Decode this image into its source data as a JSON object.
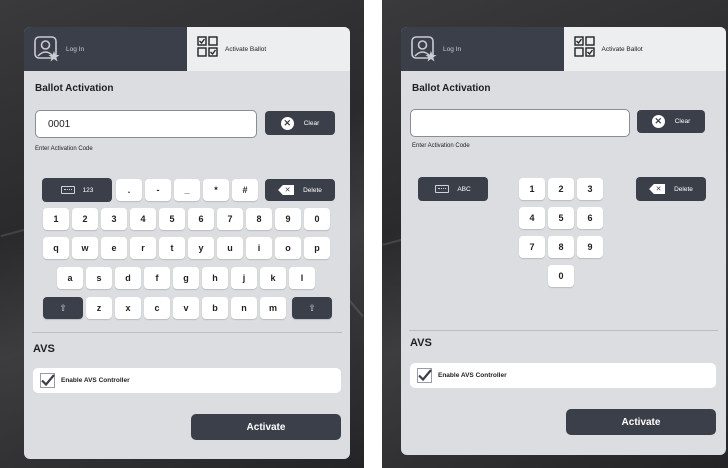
{
  "left": {
    "tabs": {
      "login": "Log In",
      "activate": "Activate Ballot"
    },
    "heading": "Ballot Activation",
    "code_value": "0001",
    "clear": "Clear",
    "hint": "Enter Activation Code",
    "mode_key": {
      "icon": "keyboard-icon",
      "label": "123"
    },
    "symbol_keys": [
      ".",
      "-",
      "_",
      "*",
      "#"
    ],
    "delete": "Delete",
    "row_numbers": [
      "1",
      "2",
      "3",
      "4",
      "5",
      "6",
      "7",
      "8",
      "9",
      "0"
    ],
    "row_q": [
      "q",
      "w",
      "e",
      "r",
      "t",
      "y",
      "u",
      "i",
      "o",
      "p"
    ],
    "row_a": [
      "a",
      "s",
      "d",
      "f",
      "g",
      "h",
      "j",
      "k",
      "l"
    ],
    "row_z": [
      "z",
      "x",
      "c",
      "v",
      "b",
      "n",
      "m"
    ],
    "shift_glyph": "⇧",
    "avs_title": "AVS",
    "avs_checkbox": "Enable AVS Controller",
    "activate": "Activate"
  },
  "right": {
    "tabs": {
      "login": "Log In",
      "activate": "Activate Ballot"
    },
    "heading": "Ballot Activation",
    "code_value": "",
    "clear": "Clear",
    "hint": "Enter Activation Code",
    "mode_key": {
      "icon": "keyboard-icon",
      "label": "ABC"
    },
    "delete": "Delete",
    "numpad": [
      [
        "1",
        "2",
        "3"
      ],
      [
        "4",
        "5",
        "6"
      ],
      [
        "7",
        "8",
        "9"
      ],
      [
        "0"
      ]
    ],
    "avs_title": "AVS",
    "avs_checkbox": "Enable AVS Controller",
    "activate": "Activate"
  },
  "colors": {
    "dark": "#3b3f49",
    "panel": "#dcdde0",
    "key": "#ffffff"
  }
}
